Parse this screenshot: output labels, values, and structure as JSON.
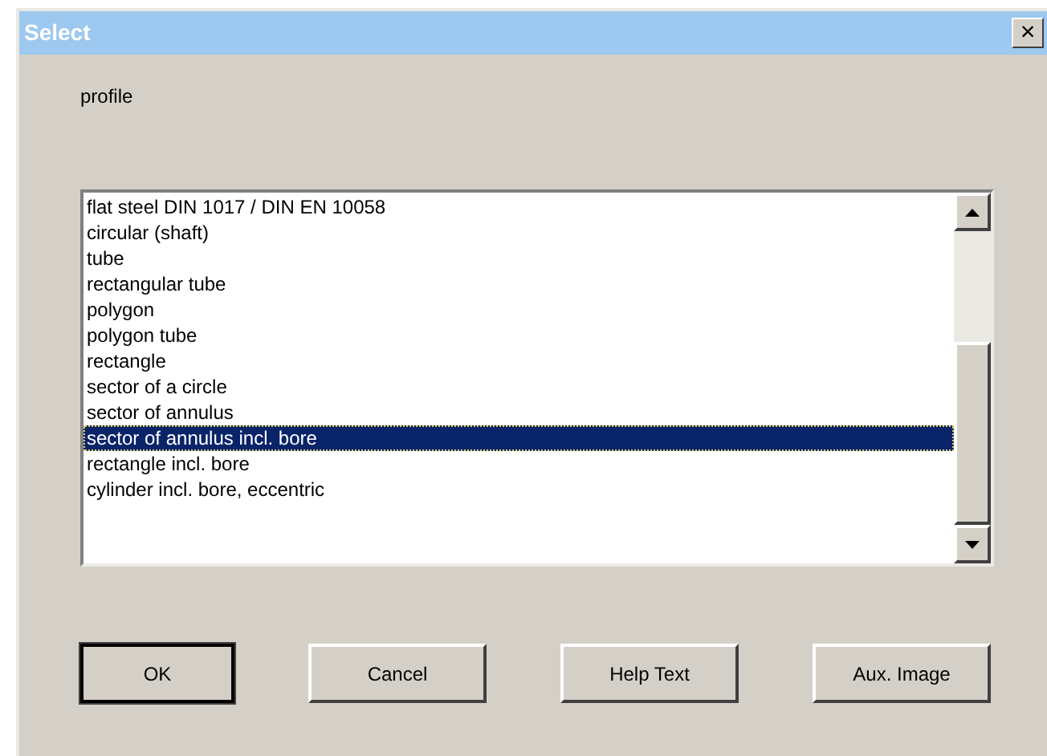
{
  "window": {
    "title": "Select",
    "close": "×"
  },
  "label": "profile",
  "list": {
    "items": [
      {
        "text": "flat steel DIN 1017 / DIN EN 10058",
        "selected": false
      },
      {
        "text": "circular (shaft)",
        "selected": false
      },
      {
        "text": "tube",
        "selected": false
      },
      {
        "text": "rectangular tube",
        "selected": false
      },
      {
        "text": "polygon",
        "selected": false
      },
      {
        "text": "polygon tube",
        "selected": false
      },
      {
        "text": "rectangle",
        "selected": false
      },
      {
        "text": "sector of a circle",
        "selected": false
      },
      {
        "text": "sector of annulus",
        "selected": false
      },
      {
        "text": "sector of annulus incl. bore",
        "selected": true
      },
      {
        "text": "rectangle incl. bore",
        "selected": false
      },
      {
        "text": "cylinder incl. bore, eccentric",
        "selected": false
      }
    ]
  },
  "buttons": [
    {
      "label": "OK",
      "default": true
    },
    {
      "label": "Cancel",
      "default": false
    },
    {
      "label": "Help Text",
      "default": false
    },
    {
      "label": "Aux. Image",
      "default": false
    }
  ]
}
